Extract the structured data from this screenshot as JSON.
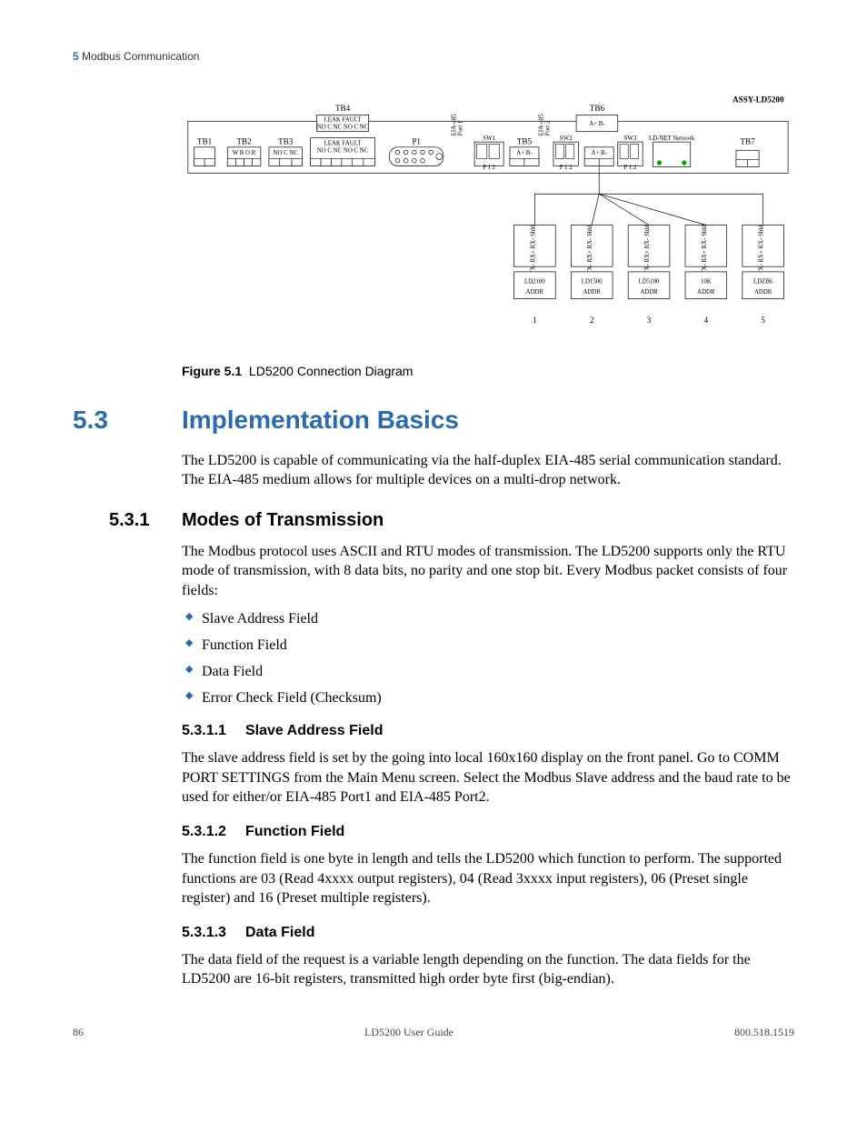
{
  "header": {
    "chapter_num": "5",
    "chapter_title": "Modbus Communication"
  },
  "diagram": {
    "assy": "ASSY-LD5200",
    "tb_top": [
      "TB4",
      "TB6"
    ],
    "tb_row": [
      "TB1",
      "TB2",
      "TB3",
      "P1",
      "TB5",
      "TB7"
    ],
    "connectors": [
      "SW1",
      "SW2",
      "SW3"
    ],
    "port_labels": [
      "A+  B-",
      "A+  B-",
      "A+  B-"
    ],
    "p12": "P 1 2",
    "bus_pins": "TX+ TX- RX+ RX- Shld",
    "devices": [
      {
        "name": "LD2100",
        "sub": "ADDR",
        "num": "1"
      },
      {
        "name": "LD1500",
        "sub": "ADDR",
        "num": "2"
      },
      {
        "name": "LD5100",
        "sub": "ADDR",
        "num": "3"
      },
      {
        "name": "10K",
        "sub": "ADDR",
        "num": "4"
      },
      {
        "name": "LDZB6",
        "sub": "ADDR",
        "num": "5"
      }
    ],
    "relay_labels": "LEAK   FAULT",
    "relay_pins": "NO C NC NO C NC",
    "relay_pins_short": "NO C NC"
  },
  "figure": {
    "label": "Figure 5.1",
    "caption": "LD5200 Connection Diagram"
  },
  "sec53": {
    "num": "5.3",
    "title": "Implementation Basics",
    "p1": "The LD5200 is capable of communicating via the half-duplex EIA-485 serial communication standard. The EIA-485 medium allows for multiple devices on a multi-drop network."
  },
  "sec531": {
    "num": "5.3.1",
    "title": "Modes of Transmission",
    "p1": "The Modbus protocol uses ASCII and RTU modes of transmission. The LD5200 supports only the RTU mode of transmission, with 8 data bits, no parity and one stop bit. Every Modbus packet consists of four fields:",
    "items": [
      "Slave Address Field",
      "Function Field",
      "Data Field",
      "Error Check Field (Checksum)"
    ]
  },
  "sec5311": {
    "num": "5.3.1.1",
    "title": "Slave Address Field",
    "p1": "The slave address field is set by the going into local 160x160 display on the front panel. Go to COMM PORT SETTINGS from the Main Menu screen. Select the Modbus Slave address and the baud rate to be used for either/or EIA-485 Port1 and EIA-485 Port2."
  },
  "sec5312": {
    "num": "5.3.1.2",
    "title": "Function Field",
    "p1": "The function field is one byte in length and tells the LD5200 which function to perform. The supported functions are 03 (Read 4xxxx output registers), 04 (Read 3xxxx input registers), 06 (Preset single register) and 16 (Preset multiple registers)."
  },
  "sec5313": {
    "num": "5.3.1.3",
    "title": "Data Field",
    "p1": "The data field of the request is a variable length depending on the function. The data fields for the LD5200 are 16-bit registers, transmitted high order byte first (big-endian)."
  },
  "footer": {
    "page": "86",
    "guide": "LD5200 User Guide",
    "phone": "800.518.1519"
  }
}
